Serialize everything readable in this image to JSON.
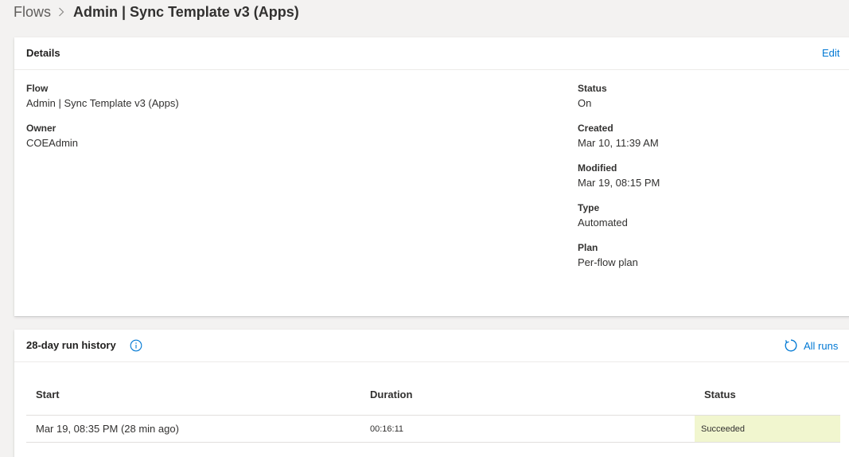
{
  "breadcrumb": {
    "root": "Flows",
    "current": "Admin | Sync Template v3 (Apps)"
  },
  "details": {
    "title": "Details",
    "edit_label": "Edit",
    "left_fields": [
      {
        "label": "Flow",
        "value": "Admin | Sync Template v3 (Apps)"
      },
      {
        "label": "Owner",
        "value": "COEAdmin"
      }
    ],
    "right_fields": [
      {
        "label": "Status",
        "value": "On"
      },
      {
        "label": "Created",
        "value": "Mar 10, 11:39 AM"
      },
      {
        "label": "Modified",
        "value": "Mar 19, 08:15 PM"
      },
      {
        "label": "Type",
        "value": "Automated"
      },
      {
        "label": "Plan",
        "value": "Per-flow plan"
      }
    ]
  },
  "run_history": {
    "title": "28-day run history",
    "all_runs_label": "All runs",
    "columns": {
      "start": "Start",
      "duration": "Duration",
      "status": "Status"
    },
    "rows": [
      {
        "start": "Mar 19, 08:35 PM (28 min ago)",
        "duration": "00:16:11",
        "status": "Succeeded"
      }
    ]
  },
  "colors": {
    "accent": "#0078d4",
    "success_bg": "#f1f6cf"
  },
  "icons": {
    "breadcrumb_separator": "chevron-right-icon",
    "info": "info-icon",
    "refresh": "refresh-icon"
  }
}
